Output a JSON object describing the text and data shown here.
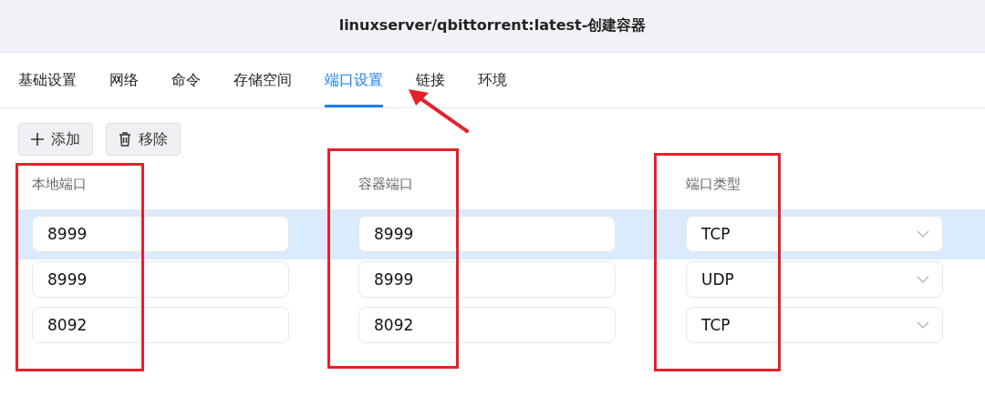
{
  "window": {
    "title": "linuxserver/qbittorrent:latest-创建容器"
  },
  "tabs": [
    {
      "label": "基础设置",
      "selected": false
    },
    {
      "label": "网络",
      "selected": false
    },
    {
      "label": "命令",
      "selected": false
    },
    {
      "label": "存储空间",
      "selected": false
    },
    {
      "label": "端口设置",
      "selected": true
    },
    {
      "label": "链接",
      "selected": false
    },
    {
      "label": "环境",
      "selected": false
    }
  ],
  "toolbar": [
    {
      "kind": "add",
      "label": "添加"
    },
    {
      "kind": "remove",
      "label": "移除"
    }
  ],
  "table": {
    "columns": [
      "本地端口",
      "容器端口",
      "端口类型"
    ],
    "rows": [
      {
        "selected": true,
        "local_port": "8999",
        "container_port": "8999",
        "type": "TCP"
      },
      {
        "selected": false,
        "local_port": "8999",
        "container_port": "8999",
        "type": "UDP"
      },
      {
        "selected": false,
        "local_port": "8092",
        "container_port": "8092",
        "type": "TCP"
      }
    ]
  }
}
